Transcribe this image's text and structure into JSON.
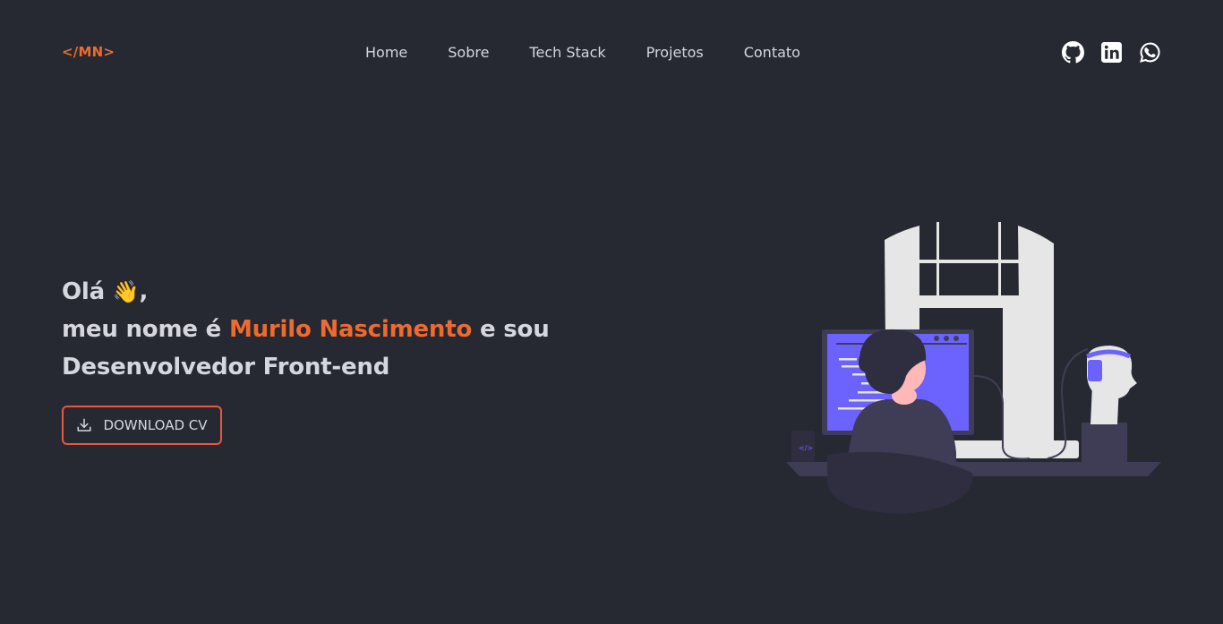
{
  "header": {
    "logo": "</MN>",
    "nav": [
      {
        "label": "Home"
      },
      {
        "label": "Sobre"
      },
      {
        "label": "Tech Stack"
      },
      {
        "label": "Projetos"
      },
      {
        "label": "Contato"
      }
    ],
    "social": [
      "github-icon",
      "linkedin-icon",
      "whatsapp-icon"
    ]
  },
  "hero": {
    "greeting": "Olá",
    "wave_emoji": "👋",
    "greeting_suffix": ",",
    "intro_prefix": "meu nome é ",
    "name": "Murilo Nascimento",
    "intro_suffix": " e sou",
    "role": "Desenvolvedor Front-end",
    "cv_button": "DOWNLOAD CV"
  },
  "colors": {
    "background": "#262932",
    "accent": "#ee6a2e",
    "text": "#d6d6df",
    "screen": "#6c63ff"
  }
}
